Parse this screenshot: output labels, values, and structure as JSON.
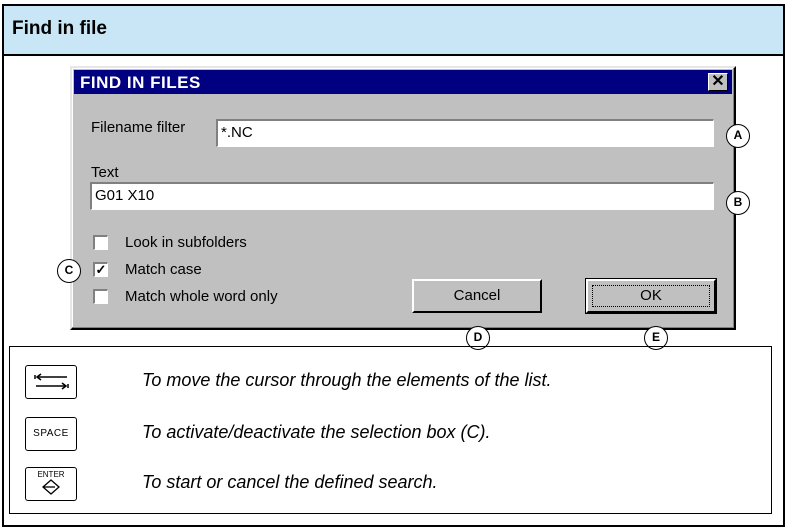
{
  "section_title": "Find in file",
  "dialog": {
    "title": "FIND IN FILES",
    "close_glyph": "✕",
    "filename_filter_label": "Filename filter",
    "filename_filter_value": "*.NC",
    "text_label": "Text",
    "text_value": "G01 X10",
    "checkboxes": [
      {
        "label": "Look in subfolders",
        "checked": false
      },
      {
        "label": "Match case",
        "checked": true
      },
      {
        "label": "Match whole word only",
        "checked": false
      }
    ],
    "cancel_label": "Cancel",
    "ok_label": "OK"
  },
  "callouts": {
    "a": "A",
    "b": "B",
    "c": "C",
    "d": "D",
    "e": "E"
  },
  "legend": [
    {
      "key": "tab-key-icon",
      "text": "To move the cursor through the elements of the list."
    },
    {
      "key": "space-key",
      "key_label": "SPACE",
      "text": "To activate/deactivate the selection box (C)."
    },
    {
      "key": "enter-key",
      "key_label": "ENTER",
      "key_symbol": "❀",
      "text": "To start or cancel the defined search."
    }
  ]
}
